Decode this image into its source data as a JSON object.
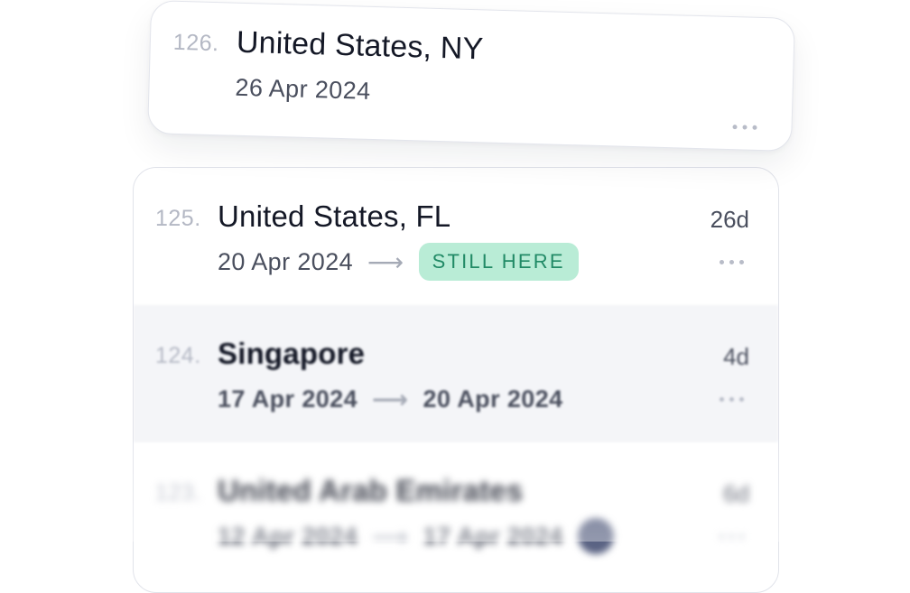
{
  "featured_card": {
    "number": "126.",
    "title": "United States, NY",
    "date": "26 Apr 2024",
    "menu_icon": "more-horizontal-icon"
  },
  "trips": [
    {
      "number": "125.",
      "title": "United States, FL",
      "start_date": "20 Apr 2024",
      "arrow": "⟶",
      "status": "STILL HERE",
      "duration": "26d",
      "menu_icon": "more-horizontal-icon"
    },
    {
      "number": "124.",
      "title": "Singapore",
      "start_date": "17 Apr 2024",
      "arrow": "⟶",
      "end_date": "20 Apr 2024",
      "duration": "4d",
      "menu_icon": "more-horizontal-icon"
    },
    {
      "number": "123.",
      "title": "United Arab Emirates",
      "start_date": "12 Apr 2024",
      "arrow": "⟶",
      "end_date": "17 Apr 2024",
      "duration": "6d",
      "menu_icon": "more-horizontal-icon"
    }
  ],
  "colors": {
    "status_badge_bg": "#b9ecd6",
    "status_badge_text": "#218a66",
    "title_text": "#141826",
    "muted_text": "#b4b8c4"
  }
}
